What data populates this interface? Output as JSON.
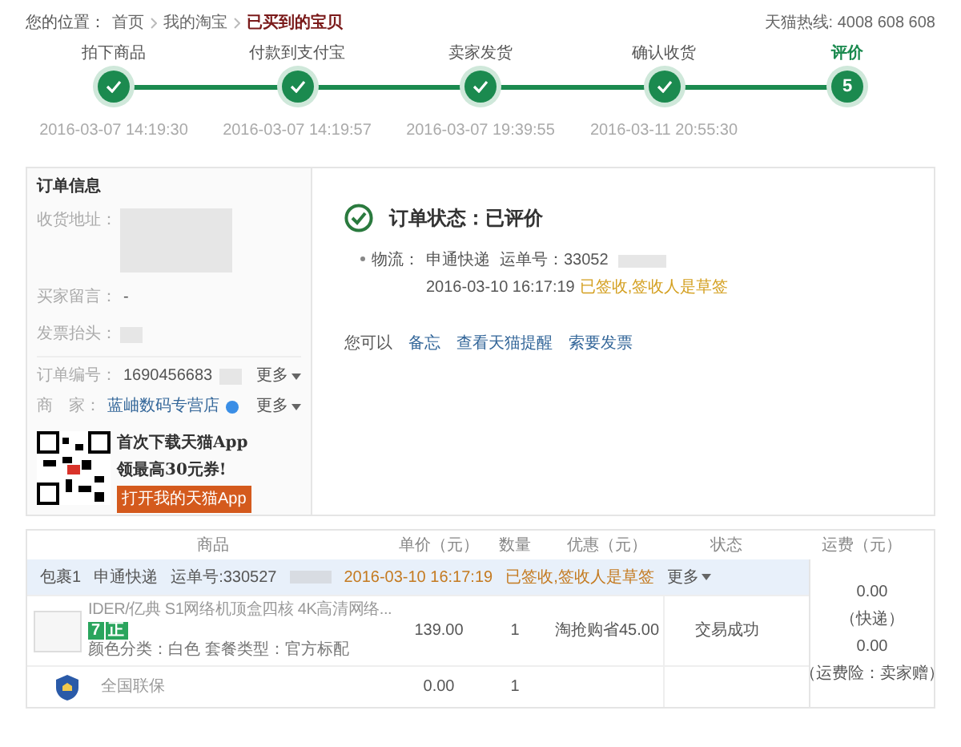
{
  "breadcrumb": {
    "label": "您的位置：",
    "items": [
      {
        "text": "首页",
        "selected": false
      },
      {
        "text": "我的淘宝",
        "selected": false
      },
      {
        "text": "已买到的宝贝",
        "selected": true
      }
    ]
  },
  "hotline": "天猫热线: 4008 608 608",
  "steps": [
    {
      "label": "拍下商品",
      "time": "2016-03-07 14:19:30",
      "done": true
    },
    {
      "label": "付款到支付宝",
      "time": "2016-03-07 14:19:57",
      "done": true
    },
    {
      "label": "卖家发货",
      "time": "2016-03-07 19:39:55",
      "done": true
    },
    {
      "label": "确认收货",
      "time": "2016-03-11 20:55:30",
      "done": true
    },
    {
      "label": "评价",
      "number": "5",
      "done": false
    }
  ],
  "order_info": {
    "title": "订单信息",
    "address_label": "收货地址：",
    "buyer_message": {
      "label": "买家留言：",
      "value": "-"
    },
    "invoice_label": "发票抬头：",
    "order_no": {
      "label": "订单编号：",
      "value": "1690456683",
      "more": "更多"
    },
    "seller": {
      "label": "商　家：",
      "value": "蓝岫数码专营店",
      "more": "更多"
    },
    "promo": {
      "line1": "首次下载天猫App",
      "line2": "领最高30元券!",
      "button": "打开我的天猫App"
    }
  },
  "status": {
    "title": "订单状态：已评价",
    "logistics_label": "物流：",
    "carrier": "申通快递",
    "waybill_label": "运单号：",
    "waybill": "33052",
    "time": "2016-03-10 16:17:19",
    "signed": "已签收,签收人是草签",
    "actions_label": "您可以",
    "actions": [
      "备忘",
      "查看天猫提醒",
      "索要发票"
    ]
  },
  "table": {
    "columns": [
      "商品",
      "单价（元）",
      "数量",
      "优惠（元）",
      "状态",
      "运费（元）"
    ],
    "package": {
      "name": "包裹1",
      "carrier": "申通快递",
      "waybill": "运单号:330527",
      "time": "2016-03-10 16:17:19",
      "signed": "已签收,签收人是草签",
      "more": "更多"
    },
    "rows": [
      {
        "kind": "product",
        "name": "IDER/亿典 S1网络机顶盒四核 4K高清网络...",
        "badges": [
          "7",
          "正"
        ],
        "attrs": "颜色分类：白色 套餐类型：官方标配",
        "price": "139.00",
        "qty": "1",
        "discount": "淘抢购省45.00",
        "status": "交易成功"
      },
      {
        "kind": "service",
        "name": "全国联保",
        "price": "0.00",
        "qty": "1"
      }
    ],
    "shipping": [
      "0.00",
      "（快递）",
      "0.00",
      "（运费险：卖家赠）"
    ]
  }
}
